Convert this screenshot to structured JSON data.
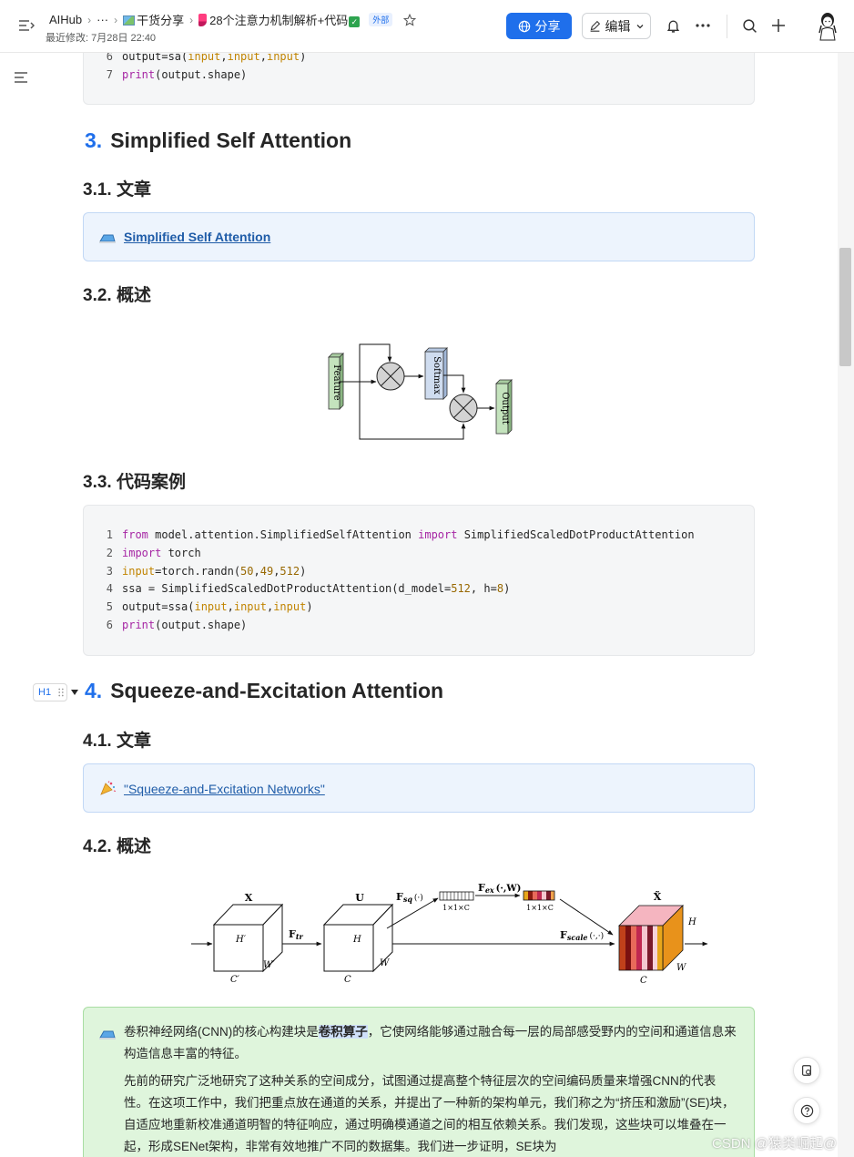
{
  "topbar": {
    "crumb_root": "AIHub",
    "crumb_more": "···",
    "crumb_folder": "干货分享",
    "doc_title": "28个注意力机制解析+代码",
    "external_tag": "外部",
    "last_edit": "最近修改: 7月28日 22:40",
    "share_label": "分享",
    "edit_label": "编辑"
  },
  "code_top": {
    "lines": [
      {
        "no": "6",
        "text": "output=sa(input,input,input)"
      },
      {
        "no": "7",
        "text": "print(output.shape)"
      }
    ]
  },
  "section3": {
    "num": "3.",
    "title": "Simplified Self Attention",
    "sub1": "3.1. 文章",
    "link": "Simplified Self Attention",
    "sub2": "3.2. 概述",
    "diagram": {
      "feature": "Feature",
      "softmax": "Softmax",
      "output": "Output"
    },
    "sub3": "3.3. 代码案例",
    "code": [
      {
        "no": "1"
      },
      {
        "no": "2"
      },
      {
        "no": "3"
      },
      {
        "no": "4"
      },
      {
        "no": "5"
      },
      {
        "no": "6"
      }
    ]
  },
  "section4": {
    "num": "4.",
    "title": "Squeeze-and-Excitation Attention",
    "heading_tag": "H1",
    "sub1": "4.1. 文章",
    "link": "\"Squeeze-and-Excitation Networks\"",
    "sub2": "4.2. 概述",
    "diagram": {
      "x": "X",
      "u": "U",
      "x_tilde": "X̃",
      "ftr": "F",
      "ftr_sub": "tr",
      "fsq": "F",
      "fsq_sub": "sq",
      "fsq_arg": "(·)",
      "fex": "F",
      "fex_sub": "ex",
      "fex_arg": "(·,W)",
      "fscale": "F",
      "fscale_sub": "scale",
      "fscale_arg": "(·,·)",
      "h_prime": "H′",
      "w_prime": "W′",
      "c_prime": "C′",
      "h": "H",
      "w": "W",
      "c": "C",
      "vec1": "1×1×C",
      "vec2": "1×1×C"
    },
    "para1_a": "卷积神经网络(CNN)的核心构建块是",
    "para1_hl": "卷积算子",
    "para1_b": "，它使网络能够通过融合每一层的局部感受野内的空间和通道信息来构造信息丰富的特征。",
    "para2": "先前的研究广泛地研究了这种关系的空间成分，试图通过提高整个特征层次的空间编码质量来增强CNN的代表性。在这项工作中，我们把重点放在通道的关系，并提出了一种新的架构单元，我们称之为“挤压和激励”(SE)块，自适应地重新校准通道明智的特征响应，通过明确模通道之间的相互依赖关系。我们发现，这些块可以堆叠在一起，形成SENet架构，非常有效地推广不同的数据集。我们进一步证明，SE块为"
  },
  "watermark": "CSDN @猿类崛起@"
}
